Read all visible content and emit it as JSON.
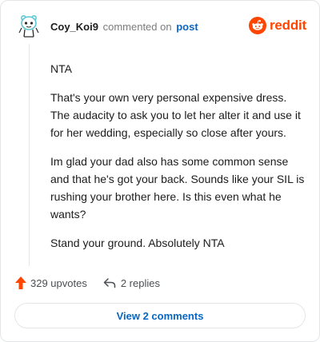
{
  "comment": {
    "username": "Coy_Koi9",
    "action_text": "commented on",
    "target_link": "post",
    "avatar_icon": "snoo-avatar-icon",
    "paragraphs": [
      "NTA",
      "That's your own very personal expensive dress. The audacity to ask you to let her alter it and use it for her wedding, especially so close after yours.",
      "Im glad your dad also has some common sense and that he's got your back. Sounds like your SIL is rushing your brother here. Is this even what he wants?",
      "Stand your ground. Absolutely NTA"
    ]
  },
  "brand": {
    "wordmark": "reddit",
    "icon": "reddit-snoo-icon",
    "color": "#ff4500"
  },
  "actions": {
    "upvotes_label": "329 upvotes",
    "upvote_icon": "upvote-arrow-icon",
    "upvote_color": "#ff4500",
    "replies_label": "2 replies",
    "reply_icon": "reply-arrow-icon"
  },
  "footer": {
    "view_comments_label": "View 2 comments"
  },
  "colors": {
    "link": "#0a66c2",
    "muted": "#7c7c7c",
    "border": "#e3e5e8"
  }
}
